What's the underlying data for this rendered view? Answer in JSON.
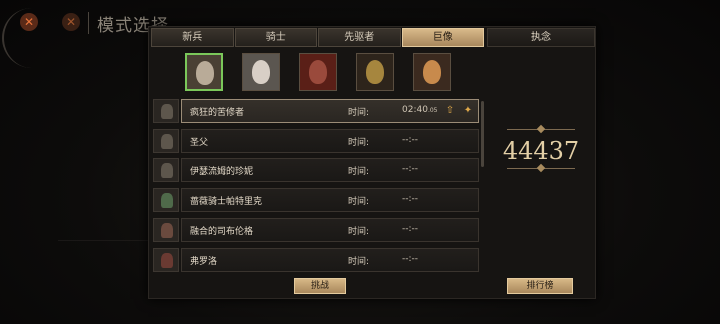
{
  "background": {
    "title": "模式选择",
    "close_icons": [
      "close-icon",
      "close-icon"
    ]
  },
  "tabs": [
    {
      "label": "新兵",
      "active": false
    },
    {
      "label": "骑士",
      "active": false
    },
    {
      "label": "先驱者",
      "active": false
    },
    {
      "label": "巨像",
      "active": true
    }
  ],
  "side_tab": {
    "label": "执念"
  },
  "portraits": [
    {
      "name": "old-man-portrait",
      "selected": true,
      "face": "#b9ab98",
      "bg": "#4a4034"
    },
    {
      "name": "white-hair-woman-portrait",
      "selected": false,
      "face": "#d8cfc6",
      "bg": "#5b5650"
    },
    {
      "name": "hooded-woman-portrait",
      "selected": false,
      "face": "#9a4a3c",
      "bg": "#5a1f17"
    },
    {
      "name": "masked-figure-portrait",
      "selected": false,
      "face": "#a6863e",
      "bg": "#2d241b"
    },
    {
      "name": "blonde-woman-portrait",
      "selected": false,
      "face": "#c88a4c",
      "bg": "#3b2a1f"
    }
  ],
  "rows": [
    {
      "name": "疯狂的苦修者",
      "time_label": "时间:",
      "time": "02:40",
      "time_ms": ".05",
      "selected": true,
      "has_buttons": true
    },
    {
      "name": "圣父",
      "time_label": "时间:",
      "time": "--:--",
      "time_ms": "",
      "selected": false,
      "has_buttons": false
    },
    {
      "name": "伊瑟流姆的珍妮",
      "time_label": "时间:",
      "time": "--:--",
      "time_ms": "",
      "selected": false,
      "has_buttons": false
    },
    {
      "name": "蔷薇骑士帕特里克",
      "time_label": "时间:",
      "time": "--:--",
      "time_ms": "",
      "selected": false,
      "has_buttons": false
    },
    {
      "name": "融合的司布伦格",
      "time_label": "时间:",
      "time": "--:--",
      "time_ms": "",
      "selected": false,
      "has_buttons": false
    },
    {
      "name": "弗罗洛",
      "time_label": "时间:",
      "time": "--:--",
      "time_ms": "",
      "selected": false,
      "has_buttons": false
    }
  ],
  "score": "44437",
  "challenge_button": "挑战",
  "leaderboard_button": "排行榜"
}
